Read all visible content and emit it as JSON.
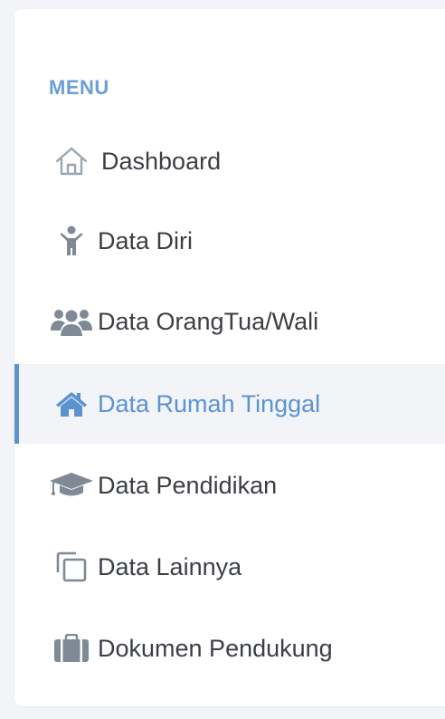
{
  "menu": {
    "title": "MENU",
    "items": [
      {
        "label": "Dashboard",
        "icon": "home-outline-icon"
      },
      {
        "label": "Data Diri",
        "icon": "child-icon"
      },
      {
        "label": "Data OrangTua/Wali",
        "icon": "users-icon"
      },
      {
        "label": "Data Rumah Tinggal",
        "icon": "home-icon",
        "active": true
      },
      {
        "label": "Data Pendidikan",
        "icon": "graduation-cap-icon"
      },
      {
        "label": "Data Lainnya",
        "icon": "copy-icon"
      },
      {
        "label": "Dokumen Pendukung",
        "icon": "briefcase-icon"
      }
    ]
  },
  "colors": {
    "accent": "#5b93d1",
    "menu_title": "#6a9fd8",
    "text": "#3b3f44",
    "icon": "#7f8a96",
    "active_bg": "#f2f4f8"
  }
}
